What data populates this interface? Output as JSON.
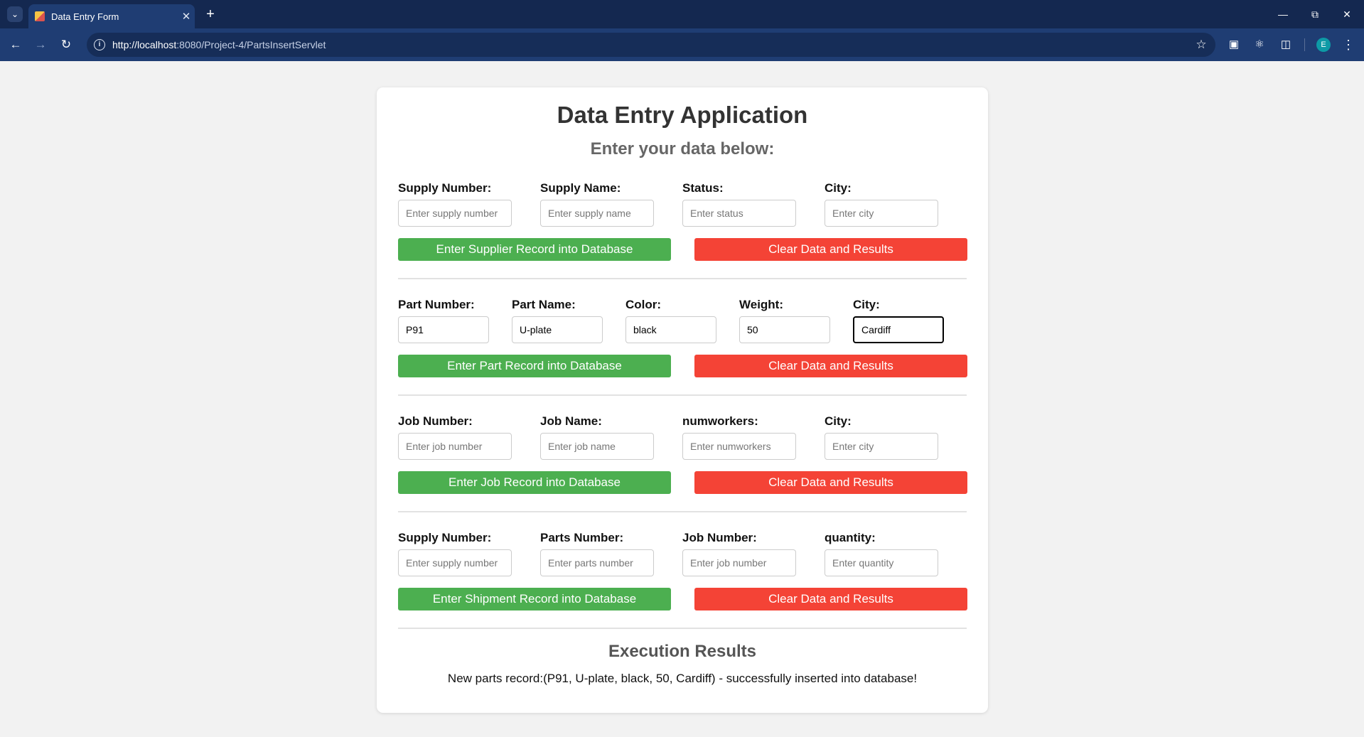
{
  "browser": {
    "tab_title": "Data Entry Form",
    "url_host": "http://localhost",
    "url_rest": ":8080/Project-4/PartsInsertServlet",
    "avatar_letter": "E"
  },
  "page": {
    "title": "Data Entry Application",
    "subtitle": "Enter your data below:"
  },
  "supplier": {
    "fields": [
      {
        "label": "Supply Number:",
        "placeholder": "Enter supply number",
        "value": ""
      },
      {
        "label": "Supply Name:",
        "placeholder": "Enter supply name",
        "value": ""
      },
      {
        "label": "Status:",
        "placeholder": "Enter status",
        "value": ""
      },
      {
        "label": "City:",
        "placeholder": "Enter city",
        "value": ""
      }
    ],
    "submit_label": "Enter Supplier Record into Database",
    "clear_label": "Clear Data and Results"
  },
  "part": {
    "fields": [
      {
        "label": "Part Number:",
        "placeholder": "",
        "value": "P91"
      },
      {
        "label": "Part Name:",
        "placeholder": "",
        "value": "U-plate"
      },
      {
        "label": "Color:",
        "placeholder": "",
        "value": "black"
      },
      {
        "label": "Weight:",
        "placeholder": "",
        "value": "50"
      },
      {
        "label": "City:",
        "placeholder": "",
        "value": "Cardiff"
      }
    ],
    "submit_label": "Enter Part Record into Database",
    "clear_label": "Clear Data and Results"
  },
  "job": {
    "fields": [
      {
        "label": "Job Number:",
        "placeholder": "Enter job number",
        "value": ""
      },
      {
        "label": "Job Name:",
        "placeholder": "Enter job name",
        "value": ""
      },
      {
        "label": "numworkers:",
        "placeholder": "Enter numworkers",
        "value": ""
      },
      {
        "label": "City:",
        "placeholder": "Enter city",
        "value": ""
      }
    ],
    "submit_label": "Enter Job Record into Database",
    "clear_label": "Clear Data and Results"
  },
  "shipment": {
    "fields": [
      {
        "label": "Supply Number:",
        "placeholder": "Enter supply number",
        "value": ""
      },
      {
        "label": "Parts Number:",
        "placeholder": "Enter parts number",
        "value": ""
      },
      {
        "label": "Job Number:",
        "placeholder": "Enter job number",
        "value": ""
      },
      {
        "label": "quantity:",
        "placeholder": "Enter quantity",
        "value": ""
      }
    ],
    "submit_label": "Enter Shipment Record into Database",
    "clear_label": "Clear Data and Results"
  },
  "results": {
    "title": "Execution Results",
    "message": "New parts record:(P91, U-plate, black, 50, Cardiff) - successfully inserted into database!"
  }
}
